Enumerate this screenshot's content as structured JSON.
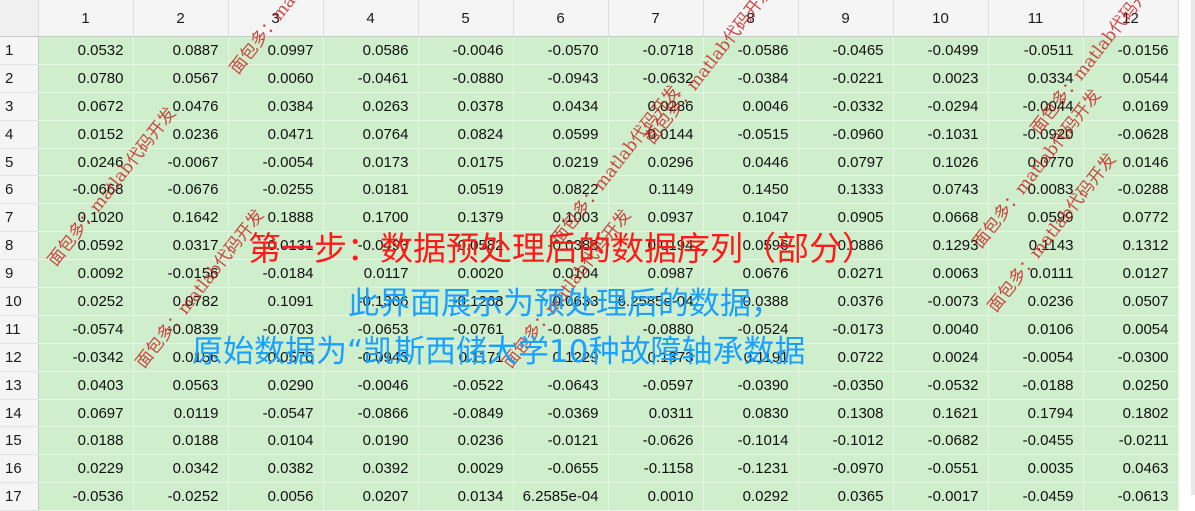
{
  "table": {
    "columns": [
      "1",
      "2",
      "3",
      "4",
      "5",
      "6",
      "7",
      "8",
      "9",
      "10",
      "11",
      "12"
    ],
    "rows": [
      {
        "label": "1",
        "cells": [
          "0.0532",
          "0.0887",
          "0.0997",
          "0.0586",
          "-0.0046",
          "-0.0570",
          "-0.0718",
          "-0.0586",
          "-0.0465",
          "-0.0499",
          "-0.0511",
          "-0.0156"
        ]
      },
      {
        "label": "2",
        "cells": [
          "0.0780",
          "0.0567",
          "0.0060",
          "-0.0461",
          "-0.0880",
          "-0.0943",
          "-0.0632",
          "-0.0384",
          "-0.0221",
          "0.0023",
          "0.0334",
          "0.0544"
        ]
      },
      {
        "label": "3",
        "cells": [
          "0.0672",
          "0.0476",
          "0.0384",
          "0.0263",
          "0.0378",
          "0.0434",
          "0.0286",
          "0.0046",
          "-0.0332",
          "-0.0294",
          "-0.0044",
          "0.0169"
        ]
      },
      {
        "label": "4",
        "cells": [
          "0.0152",
          "0.0236",
          "0.0471",
          "0.0764",
          "0.0824",
          "0.0599",
          "0.0144",
          "-0.0515",
          "-0.0960",
          "-0.1031",
          "-0.0920",
          "-0.0628"
        ]
      },
      {
        "label": "5",
        "cells": [
          "0.0246",
          "-0.0067",
          "-0.0054",
          "0.0173",
          "0.0175",
          "0.0219",
          "0.0296",
          "0.0446",
          "0.0797",
          "0.1026",
          "0.0770",
          "0.0146"
        ]
      },
      {
        "label": "6",
        "cells": [
          "-0.0668",
          "-0.0676",
          "-0.0255",
          "0.0181",
          "0.0519",
          "0.0822",
          "0.1149",
          "0.1450",
          "0.1333",
          "0.0743",
          "0.0083",
          "-0.0288"
        ]
      },
      {
        "label": "7",
        "cells": [
          "0.1020",
          "0.1642",
          "0.1888",
          "0.1700",
          "0.1379",
          "0.1003",
          "0.0937",
          "0.1047",
          "0.0905",
          "0.0668",
          "0.0599",
          "0.0772"
        ]
      },
      {
        "label": "8",
        "cells": [
          "0.0592",
          "0.0317",
          "0.0131",
          "-0.0493",
          "-0.0582",
          "-0.0388",
          "0.0194",
          "0.0596",
          "0.0886",
          "0.1293",
          "0.1143",
          "0.1312"
        ]
      },
      {
        "label": "9",
        "cells": [
          "0.0092",
          "-0.0156",
          "-0.0184",
          "0.0117",
          "0.0020",
          "0.0104",
          "0.0987",
          "0.0676",
          "0.0271",
          "0.0063",
          "0.0111",
          "0.0127"
        ]
      },
      {
        "label": "10",
        "cells": [
          "0.0252",
          "0.0782",
          "0.1091",
          "-0.1306",
          "-0.1268",
          "0.0633",
          "6.2585e-04",
          "0.0388",
          "0.0376",
          "-0.0073",
          "0.0236",
          "0.0507"
        ]
      },
      {
        "label": "11",
        "cells": [
          "-0.0574",
          "-0.0839",
          "-0.0703",
          "-0.0653",
          "-0.0761",
          "-0.0885",
          "-0.0880",
          "-0.0524",
          "-0.0173",
          "0.0040",
          "0.0106",
          "0.0054"
        ]
      },
      {
        "label": "12",
        "cells": [
          "-0.0342",
          "0.0156",
          "0.0576",
          "-0.0943",
          "0.1171",
          "0.1229",
          "0.1373",
          "0.1191",
          "0.0722",
          "0.0024",
          "-0.0054",
          "-0.0300"
        ]
      },
      {
        "label": "13",
        "cells": [
          "0.0403",
          "0.0563",
          "0.0290",
          "-0.0046",
          "-0.0522",
          "-0.0643",
          "-0.0597",
          "-0.0390",
          "-0.0350",
          "-0.0532",
          "-0.0188",
          "0.0250"
        ]
      },
      {
        "label": "14",
        "cells": [
          "0.0697",
          "0.0119",
          "-0.0547",
          "-0.0866",
          "-0.0849",
          "-0.0369",
          "0.0311",
          "0.0830",
          "0.1308",
          "0.1621",
          "0.1794",
          "0.1802"
        ]
      },
      {
        "label": "15",
        "cells": [
          "0.0188",
          "0.0188",
          "0.0104",
          "0.0190",
          "0.0236",
          "-0.0121",
          "-0.0626",
          "-0.1014",
          "-0.1012",
          "-0.0682",
          "-0.0455",
          "-0.0211"
        ]
      },
      {
        "label": "16",
        "cells": [
          "0.0229",
          "0.0342",
          "0.0382",
          "0.0392",
          "0.0029",
          "-0.0655",
          "-0.1158",
          "-0.1231",
          "-0.0970",
          "-0.0551",
          "0.0035",
          "0.0463"
        ]
      },
      {
        "label": "17",
        "cells": [
          "-0.0536",
          "-0.0252",
          "0.0056",
          "0.0207",
          "0.0134",
          "6.2585e-04",
          "0.0010",
          "0.0292",
          "0.0365",
          "-0.0017",
          "-0.0459",
          "-0.0613"
        ]
      }
    ]
  },
  "overlay": {
    "title": "第一步：数据预处理后的数据序列（部分）",
    "line1": "此界面展示为预处理后的数据，",
    "line2": "原始数据为“凯斯西储大学10种故障轴承数据"
  },
  "watermark": {
    "text": "面包多：matlab代码开发"
  },
  "colors": {
    "cell_bg": "#cfeecb",
    "header_bg": "#f5f5f5",
    "title_red": "#ff1a1a",
    "overlay_blue": "#1aa0ff",
    "watermark_red": "#c82828"
  }
}
